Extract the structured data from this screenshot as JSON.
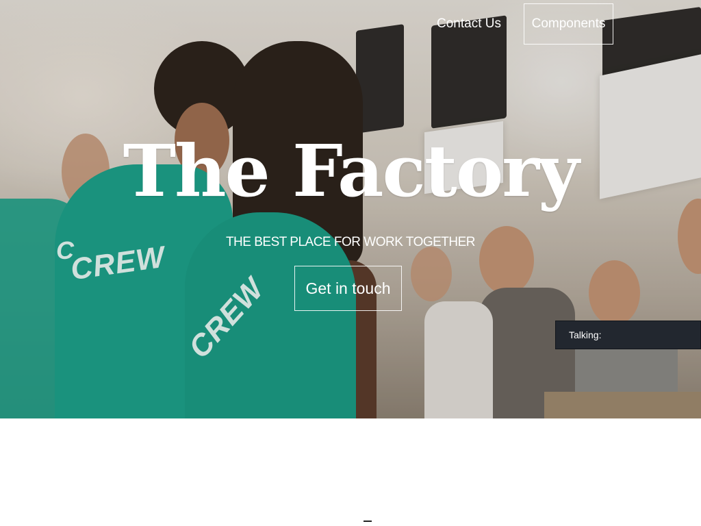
{
  "nav": {
    "contact_label": "Contact Us",
    "components_label": "Components"
  },
  "hero": {
    "title": "The Factory",
    "tagline": "THE BEST PLACE FOR WORK TOGETHER",
    "cta_label": "Get in touch",
    "shirt_text_left": "CREW",
    "shirt_text_left_partial": "C",
    "shirt_text_center": "CREW"
  },
  "panel": {
    "talking_label": "Talking:"
  },
  "colors": {
    "shirt": "#1aa28a",
    "panel_bg": "#22272f"
  }
}
